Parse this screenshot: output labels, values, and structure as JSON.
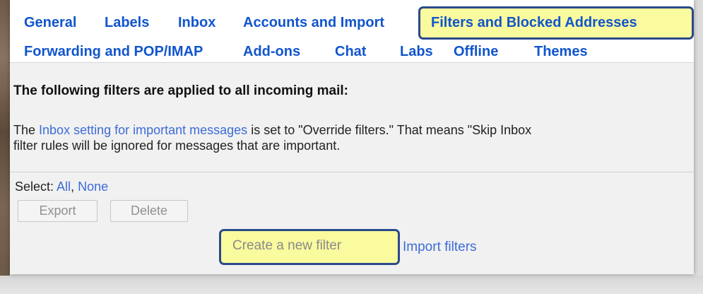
{
  "tabs": {
    "row1": [
      "General",
      "Labels",
      "Inbox",
      "Accounts and Import",
      "Filters and Blocked Addresses"
    ],
    "row2": [
      "Forwarding and POP/IMAP",
      "Add-ons",
      "Chat",
      "Labs",
      "Offline",
      "Themes"
    ],
    "active": "Filters and Blocked Addresses"
  },
  "filters": {
    "heading": "The following filters are applied to all incoming mail:",
    "info_prefix": "The ",
    "info_link": "Inbox setting for important messages",
    "info_line1_rest": " is set to \"Override filters.\" That means \"Skip Inbox",
    "info_line2": "filter rules will be ignored for messages that are important."
  },
  "select": {
    "label": "Select: ",
    "all": "All",
    "separator": ", ",
    "none": "None"
  },
  "buttons": {
    "export": "Export",
    "delete": "Delete",
    "create": "Create a new filter",
    "import": "Import filters"
  },
  "colors": {
    "link": "#1155cc",
    "highlight": "#fafa9e",
    "highlight_border": "#2a4a8c"
  }
}
